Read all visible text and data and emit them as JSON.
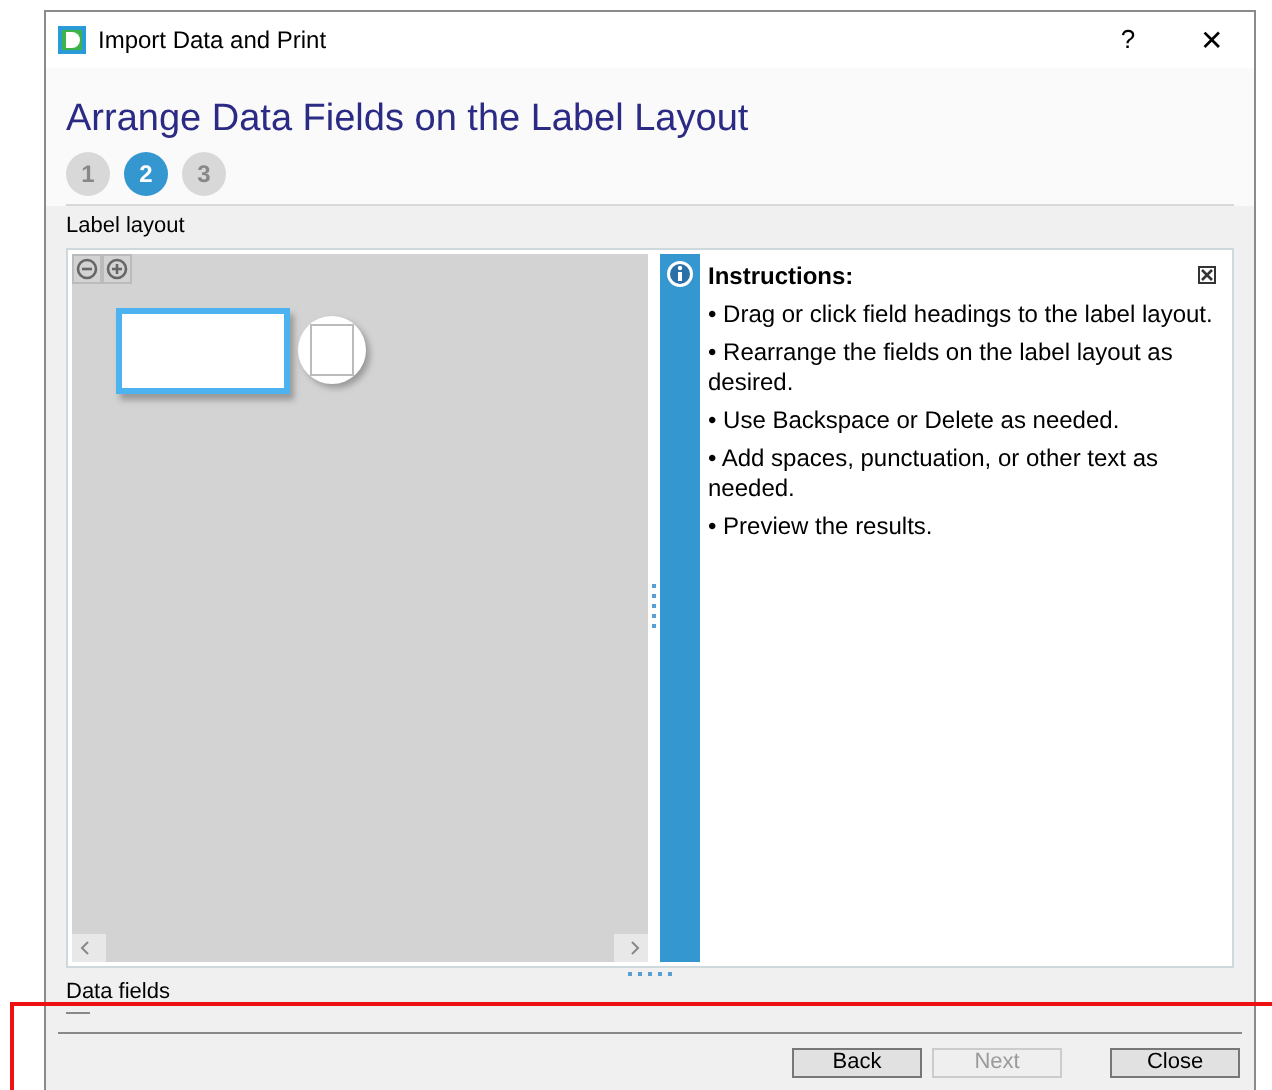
{
  "window": {
    "title": "Import Data and Print",
    "help": "?",
    "close": "✕"
  },
  "heading": "Arrange Data Fields on the Label Layout",
  "steps": [
    {
      "label": "1",
      "selected": false
    },
    {
      "label": "2",
      "selected": true
    },
    {
      "label": "3",
      "selected": false
    }
  ],
  "label_layout": {
    "title": "Label layout"
  },
  "instructions": {
    "title": "Instructions:",
    "items": [
      "• Drag or click field headings to the label layout.",
      "• Rearrange the fields on the label layout as desired.",
      "• Use Backspace or Delete as needed.",
      "• Add spaces, punctuation, or other text as needed.",
      "• Preview the results."
    ]
  },
  "data_fields": {
    "title": "Data fields"
  },
  "buttons": [
    {
      "label": "Back",
      "disabled": false
    },
    {
      "label": "Next",
      "disabled": true
    },
    {
      "label": "Close",
      "disabled": false
    }
  ]
}
